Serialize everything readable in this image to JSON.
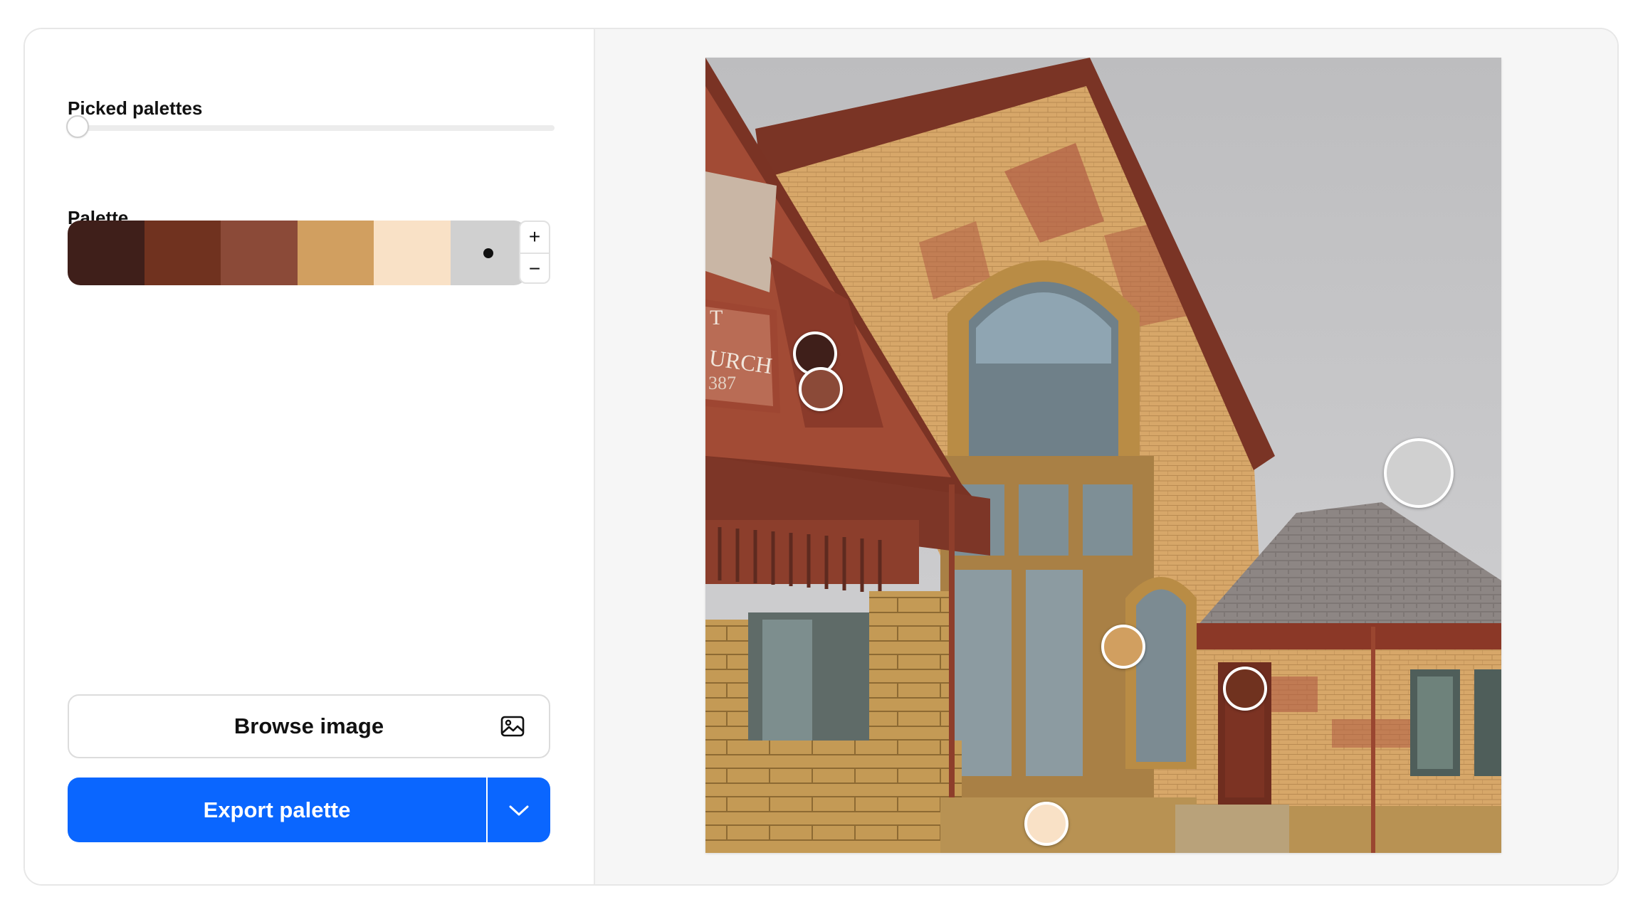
{
  "sidebar": {
    "picked_palettes_label": "Picked palettes",
    "picked_palettes_value": 0,
    "palette_label": "Palette",
    "palette_colors": [
      "#3f1f1a",
      "#70321f",
      "#8b4a38",
      "#d19f60",
      "#f9e1c6",
      "#d0d0d0"
    ],
    "selected_swatch_index": 5,
    "stepper_plus": "+",
    "stepper_minus": "−",
    "browse_label": "Browse image",
    "export_label": "Export palette"
  },
  "image": {
    "sign_text_line1": "T",
    "sign_text_line2": "URCH",
    "sign_text_line3": "387"
  },
  "icons": {
    "browse": "image-icon",
    "export_dropdown": "chevron-down-icon"
  }
}
